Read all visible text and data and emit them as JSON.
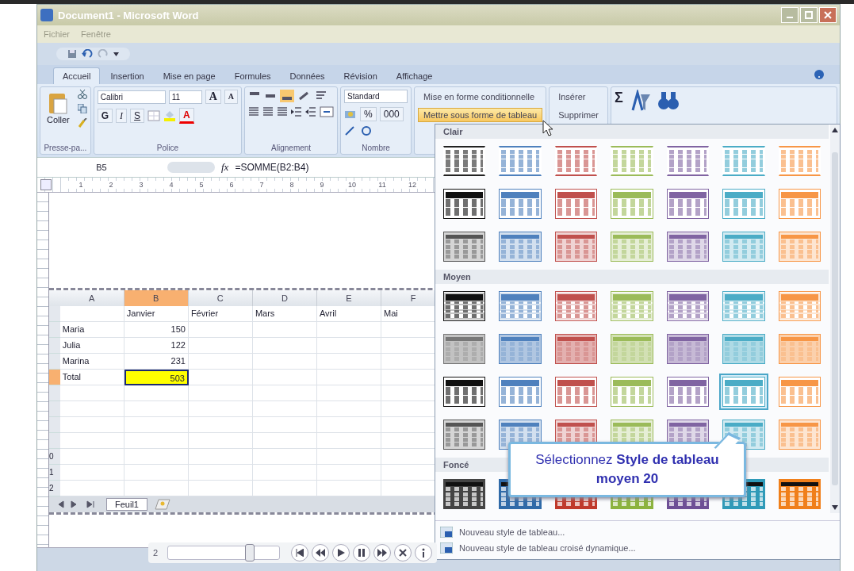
{
  "window": {
    "title": "Document1 - Microsoft Word"
  },
  "menu": [
    "Fichier",
    "Fenêtre"
  ],
  "tabs": [
    {
      "label": "Accueil",
      "selected": true
    },
    {
      "label": "Insertion",
      "selected": false
    },
    {
      "label": "Mise en page",
      "selected": false
    },
    {
      "label": "Formules",
      "selected": false
    },
    {
      "label": "Données",
      "selected": false
    },
    {
      "label": "Révision",
      "selected": false
    },
    {
      "label": "Affichage",
      "selected": false
    }
  ],
  "ribbon": {
    "paste_label": "Coller",
    "font": "Calibri",
    "size": "11",
    "grow": "A",
    "shrink": "A",
    "bold": "G",
    "italic": "I",
    "underline": "S",
    "font_color": "A",
    "number_format": "Standard",
    "percent": "%",
    "thousands": "000",
    "conditional": "Mise en forme conditionnelle",
    "format_table": {
      "label": "Mettre sous forme de tableau",
      "selected": true
    },
    "insert": "Insérer",
    "delete": "Supprimer",
    "sum": "Σ",
    "groups": [
      "Presse-pa...",
      "Police",
      "Alignement",
      "Nombre"
    ]
  },
  "formula_bar": {
    "cell": "B5",
    "fx": "fx",
    "formula": "=SOMME(B2:B4)"
  },
  "ruler": [
    "1",
    "2",
    "3",
    "4",
    "5",
    "6",
    "7",
    "8",
    "9",
    "10",
    "11",
    "12"
  ],
  "sheet": {
    "columns": [
      {
        "label": "A",
        "selected": false
      },
      {
        "label": "B",
        "selected": true
      },
      {
        "label": "C",
        "selected": false
      },
      {
        "label": "D",
        "selected": false
      },
      {
        "label": "E",
        "selected": false
      },
      {
        "label": "F",
        "selected": false
      }
    ],
    "rows": [
      {
        "selected": false,
        "cells": [
          {
            "text": "",
            "selected": false
          },
          {
            "text": "Janvier",
            "selected": false
          },
          {
            "text": "Février",
            "selected": false
          },
          {
            "text": "Mars",
            "selected": false
          },
          {
            "text": "Avril",
            "selected": false
          },
          {
            "text": "Mai",
            "selected": false
          }
        ]
      },
      {
        "selected": false,
        "cells": [
          {
            "text": "Maria",
            "selected": false
          },
          {
            "text": "150",
            "selected": false
          },
          {
            "text": "",
            "selected": false
          },
          {
            "text": "",
            "selected": false
          },
          {
            "text": "",
            "selected": false
          },
          {
            "text": "",
            "selected": false
          }
        ]
      },
      {
        "selected": false,
        "cells": [
          {
            "text": "Julia",
            "selected": false
          },
          {
            "text": "122",
            "selected": false
          },
          {
            "text": "",
            "selected": false
          },
          {
            "text": "",
            "selected": false
          },
          {
            "text": "",
            "selected": false
          },
          {
            "text": "",
            "selected": false
          }
        ]
      },
      {
        "selected": false,
        "cells": [
          {
            "text": "Marina",
            "selected": false
          },
          {
            "text": "231",
            "selected": false
          },
          {
            "text": "",
            "selected": false
          },
          {
            "text": "",
            "selected": false
          },
          {
            "text": "",
            "selected": false
          },
          {
            "text": "",
            "selected": false
          }
        ]
      },
      {
        "selected": true,
        "cells": [
          {
            "text": "Total",
            "selected": false
          },
          {
            "text": "503",
            "selected": true
          },
          {
            "text": "",
            "selected": false
          },
          {
            "text": "",
            "selected": false
          },
          {
            "text": "",
            "selected": false
          },
          {
            "text": "",
            "selected": false
          }
        ]
      },
      {
        "selected": false,
        "cells": [
          "",
          "",
          "",
          "",
          "",
          ""
        ]
      },
      {
        "selected": false,
        "cells": [
          "",
          "",
          "",
          "",
          "",
          ""
        ]
      },
      {
        "selected": false,
        "cells": [
          "",
          "",
          "",
          "",
          "",
          ""
        ]
      },
      {
        "selected": false,
        "cells": [
          "",
          "",
          "",
          "",
          "",
          ""
        ]
      },
      {
        "selected": false,
        "header": "0",
        "cells": [
          "",
          "",
          "",
          "",
          "",
          ""
        ]
      },
      {
        "selected": false,
        "header": "1",
        "cells": [
          "",
          "",
          "",
          "",
          "",
          ""
        ]
      },
      {
        "selected": false,
        "header": "2",
        "cells": [
          "",
          "",
          "",
          "",
          "",
          ""
        ]
      }
    ],
    "sheet_tab": "Feuil1"
  },
  "gallery": {
    "sections": [
      {
        "title": "Clair",
        "rows": [
          {
            "kind": "lines",
            "items": [
              {
                "color": "#222222",
                "selected": false
              },
              {
                "color": "#4f81bd",
                "selected": false
              },
              {
                "color": "#c0504d",
                "selected": false
              },
              {
                "color": "#9bbb59",
                "selected": false
              },
              {
                "color": "#8064a2",
                "selected": false
              },
              {
                "color": "#4bacc6",
                "selected": false
              },
              {
                "color": "#f79646",
                "selected": false
              }
            ]
          },
          {
            "kind": "header",
            "items": [
              {
                "color": "#111111",
                "selected": false
              },
              {
                "color": "#4f81bd",
                "selected": false
              },
              {
                "color": "#c0504d",
                "selected": false
              },
              {
                "color": "#9bbb59",
                "selected": false
              },
              {
                "color": "#8064a2",
                "selected": false
              },
              {
                "color": "#4bacc6",
                "selected": false
              },
              {
                "color": "#f79646",
                "selected": false
              }
            ]
          },
          {
            "kind": "grid",
            "items": [
              {
                "color": "#555555",
                "selected": false
              },
              {
                "color": "#4f81bd",
                "selected": false
              },
              {
                "color": "#c0504d",
                "selected": false
              },
              {
                "color": "#9bbb59",
                "selected": false
              },
              {
                "color": "#8064a2",
                "selected": false
              },
              {
                "color": "#4bacc6",
                "selected": false
              },
              {
                "color": "#f79646",
                "selected": false
              }
            ]
          }
        ]
      },
      {
        "title": "Moyen",
        "rows": [
          {
            "kind": "banded",
            "items": [
              {
                "color": "#111111",
                "selected": false
              },
              {
                "color": "#4f81bd",
                "selected": false
              },
              {
                "color": "#c0504d",
                "selected": false
              },
              {
                "color": "#9bbb59",
                "selected": false
              },
              {
                "color": "#8064a2",
                "selected": false
              },
              {
                "color": "#4bacc6",
                "selected": false
              },
              {
                "color": "#f79646",
                "selected": false
              }
            ]
          },
          {
            "kind": "filled",
            "items": [
              {
                "color": "#777777",
                "selected": false
              },
              {
                "color": "#4f81bd",
                "selected": false
              },
              {
                "color": "#c0504d",
                "selected": false
              },
              {
                "color": "#9bbb59",
                "selected": false
              },
              {
                "color": "#8064a2",
                "selected": false
              },
              {
                "color": "#4bacc6",
                "selected": false
              },
              {
                "color": "#f79646",
                "selected": false
              }
            ]
          },
          {
            "kind": "header",
            "items": [
              {
                "color": "#111111",
                "selected": false
              },
              {
                "color": "#4f81bd",
                "selected": false
              },
              {
                "color": "#c0504d",
                "selected": false
              },
              {
                "color": "#9bbb59",
                "selected": false
              },
              {
                "color": "#8064a2",
                "selected": false
              },
              {
                "color": "#4bacc6",
                "selected": true
              },
              {
                "color": "#f79646",
                "selected": false
              }
            ]
          },
          {
            "kind": "grid",
            "items": [
              {
                "color": "#555555",
                "selected": false
              },
              {
                "color": "#4f81bd",
                "selected": false
              },
              {
                "color": "#c0504d",
                "selected": false
              },
              {
                "color": "#9bbb59",
                "selected": false
              },
              {
                "color": "#8064a2",
                "selected": false
              },
              {
                "color": "#4bacc6",
                "selected": false
              },
              {
                "color": "#f79646",
                "selected": false
              }
            ]
          }
        ]
      },
      {
        "title": "Foncé",
        "rows": [
          {
            "kind": "dark",
            "items": [
              {
                "color": "#444444",
                "selected": false
              },
              {
                "color": "#2f6aa8",
                "selected": false
              },
              {
                "color": "#c0392b",
                "selected": false
              },
              {
                "color": "#8cb33e",
                "selected": false
              },
              {
                "color": "#6e4f96",
                "selected": false
              },
              {
                "color": "#2f9ab8",
                "selected": false
              },
              {
                "color": "#f07f1a",
                "selected": false
              }
            ]
          }
        ]
      }
    ],
    "menu_items": [
      "Nouveau style de tableau...",
      "Nouveau style de tableau croisé dynamique..."
    ]
  },
  "callout": "Sélectionnez **Style de tableau moyen 20**",
  "player": {
    "page": "2",
    "level": 0.73
  }
}
